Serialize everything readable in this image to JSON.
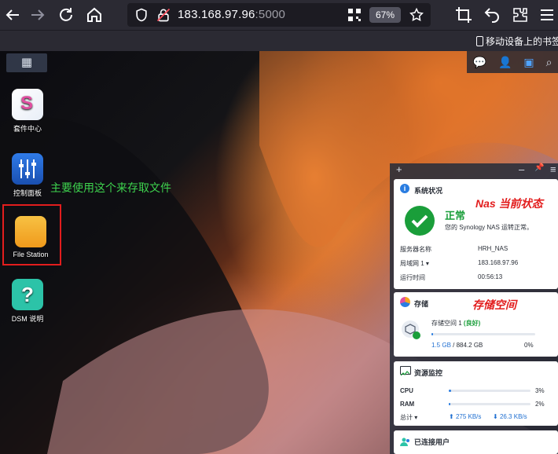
{
  "browser": {
    "url_host": "183.168.97.96",
    "url_port": ":5000",
    "zoom": "67%",
    "bookmark_label": "移动设备上的书签"
  },
  "desktop": {
    "icons": [
      {
        "label": "套件中心"
      },
      {
        "label": "控制面板"
      },
      {
        "label": "File Station"
      },
      {
        "label": "DSM 说明"
      }
    ],
    "annotation": "主要使用这个来存取文件"
  },
  "widgets": {
    "system": {
      "title": "系统状况",
      "status": "正常",
      "status_desc": "您的 Synology NAS 运转正常。",
      "annotation": "Nas 当前状态",
      "rows": [
        {
          "label": "服务器名称",
          "value": "HRH_NAS"
        },
        {
          "label": "局域网 1",
          "value": "183.168.97.96"
        },
        {
          "label": "运行时间",
          "value": "00:56:13"
        }
      ]
    },
    "storage": {
      "title": "存储",
      "annotation": "存储空间",
      "volume_label": "存储空间 1",
      "volume_status": "(良好)",
      "used": "1.5 GB",
      "total": "/ 884.2 GB",
      "percent_label": "0%",
      "percent": 0
    },
    "monitor": {
      "title": "资源监控",
      "cpu_label": "CPU",
      "cpu_value": "3%",
      "cpu_percent": 3,
      "ram_label": "RAM",
      "ram_value": "2%",
      "ram_percent": 2,
      "total_label": "总计",
      "upload": "275 KB/s",
      "download": "26.3 KB/s"
    },
    "users": {
      "title": "已连接用户"
    }
  },
  "colors": {
    "accent": "#2a7de1",
    "status_green": "#1a9e3a",
    "annotation_red": "#e21d1d",
    "annotation_green": "#3ed34e"
  }
}
